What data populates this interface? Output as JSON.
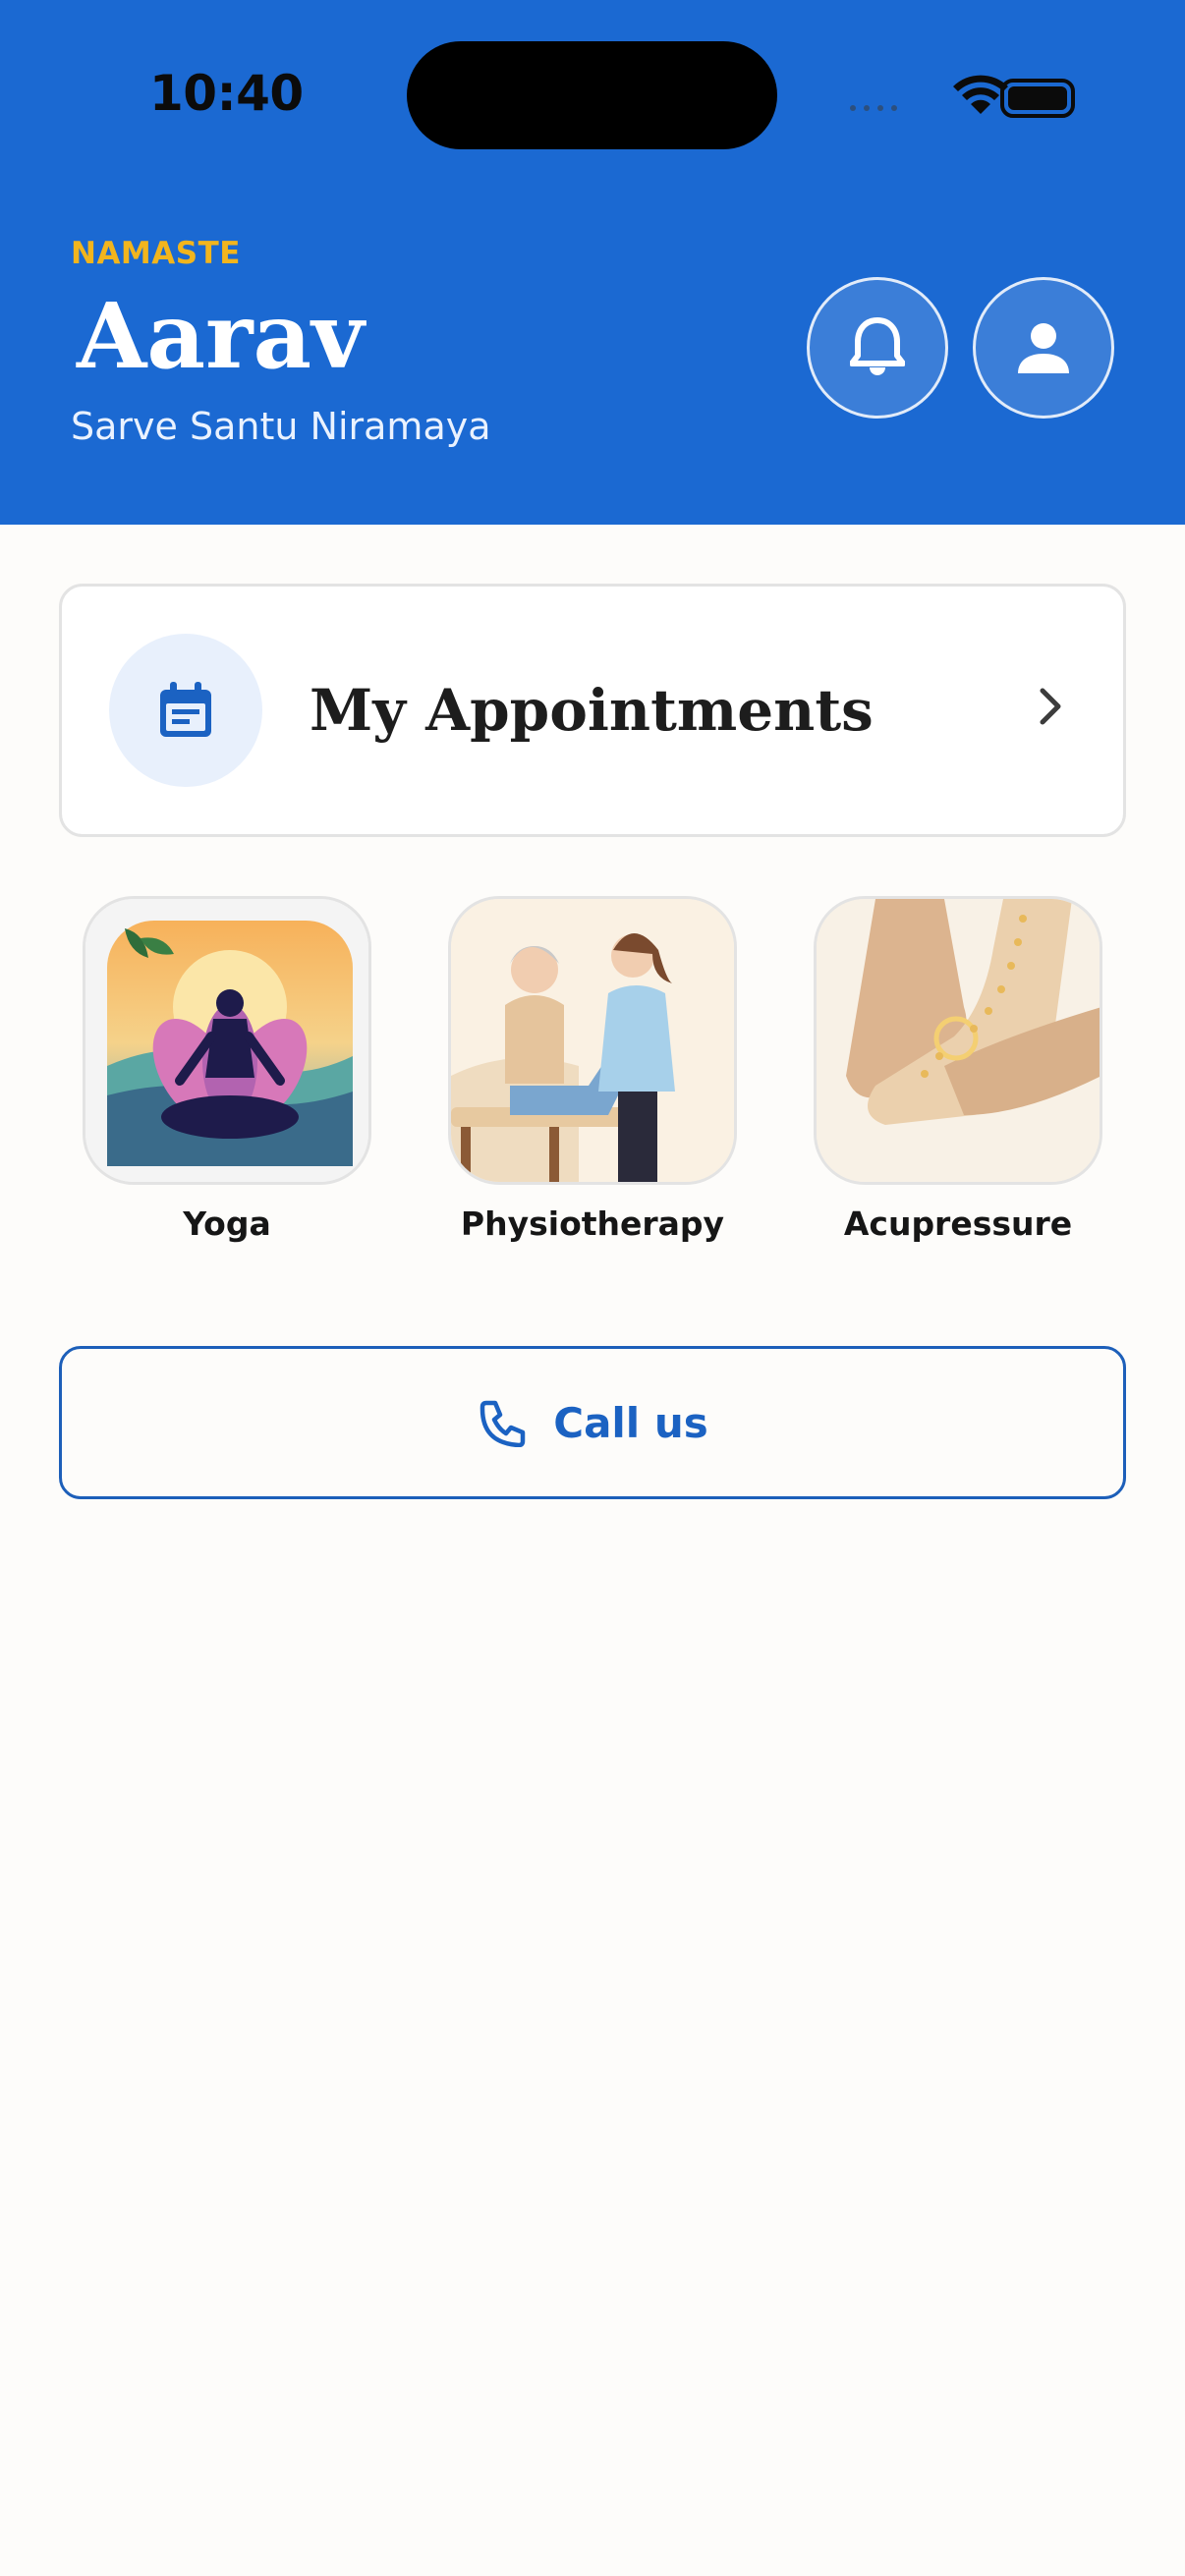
{
  "status_bar": {
    "time": "10:40"
  },
  "header": {
    "greeting": "NAMASTE",
    "name": "Aarav",
    "tagline": "Sarve Santu Niramaya",
    "notification_icon": "bell-icon",
    "profile_icon": "person-icon"
  },
  "appointments": {
    "label": "My Appointments",
    "icon": "calendar-icon"
  },
  "services": [
    {
      "label": "Yoga"
    },
    {
      "label": "Physiotherapy"
    },
    {
      "label": "Acupressure"
    }
  ],
  "call": {
    "label": "Call us",
    "icon": "phone-icon"
  },
  "colors": {
    "header_bg": "#1b69d2",
    "greeting": "#f2b51d",
    "accent": "#1b62c2",
    "page_bg": "#fdfcfa"
  }
}
